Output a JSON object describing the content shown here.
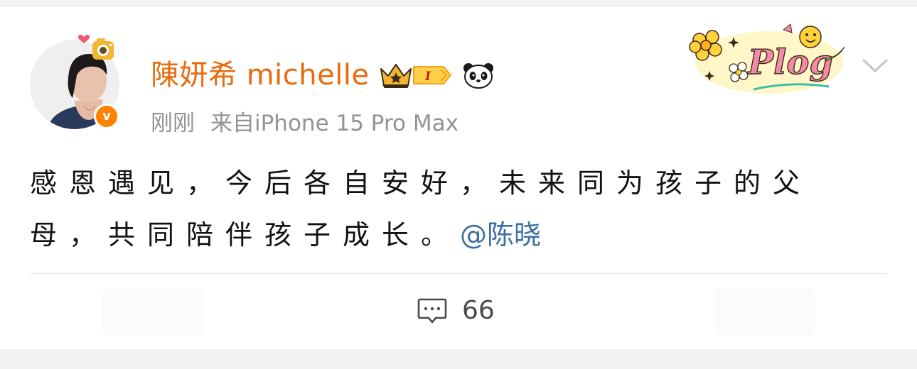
{
  "post": {
    "author": {
      "name": "陳妍希 michelle",
      "avatar_icon": "avatar-photo",
      "verified_icon": "orange-v-verified-icon",
      "verified_letter": "v",
      "badges": [
        "crown-icon",
        "member-level-badge",
        "panda-icon"
      ],
      "member_level": "I"
    },
    "meta": {
      "time": "刚刚",
      "source": "来自iPhone 15 Pro Max"
    },
    "decoration": {
      "plog_text": "Plog"
    },
    "content": {
      "text": "感恩遇见，今后各自安好，未来同为孩子的父母，共同陪伴孩子成长。",
      "mention": "@陈晓"
    },
    "actions": {
      "comments_count": "66"
    }
  },
  "colors": {
    "author_name": "#e86b0c",
    "meta_text": "#939393",
    "mention": "#3c6fa3",
    "verified_badge": "#ff8200",
    "page_background": "#f2f2f2"
  }
}
